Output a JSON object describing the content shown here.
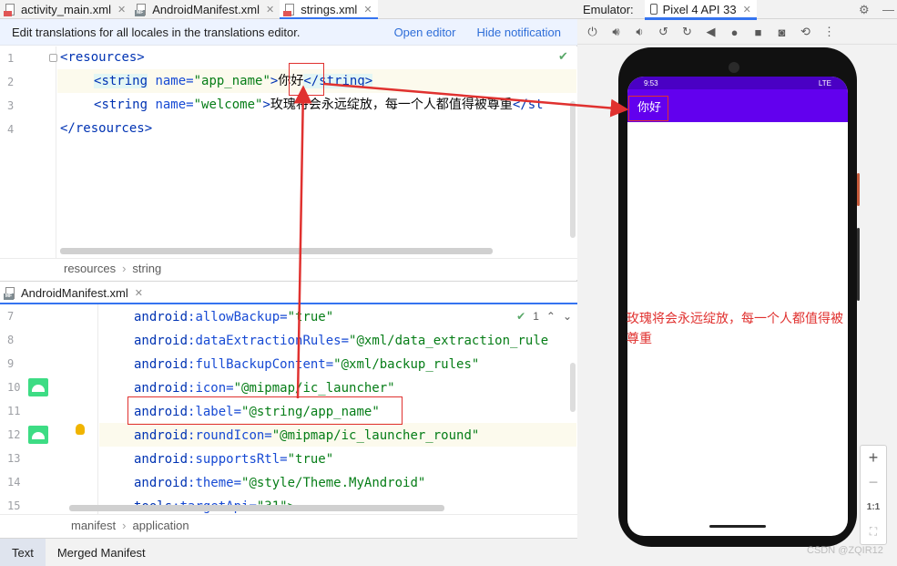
{
  "editor_tabs": [
    {
      "label": "activity_main.xml",
      "active": false
    },
    {
      "label": "AndroidManifest.xml",
      "active": false
    },
    {
      "label": "strings.xml",
      "active": true
    }
  ],
  "notification": {
    "message": "Edit translations for all locales in the translations editor.",
    "open_editor": "Open editor",
    "hide": "Hide notification"
  },
  "strings_editor": {
    "line_numbers": [
      "1",
      "2",
      "3",
      "4"
    ],
    "line1": {
      "open": "<",
      "tag": "resources",
      "close": ">"
    },
    "line2": {
      "open": "<",
      "tag": "string",
      "attr": " name=",
      "val": "\"app_name\"",
      "gt": ">",
      "text": "你好",
      "endtag": "</string>"
    },
    "line3": {
      "open": "<",
      "tag": "string",
      "attr": " name=",
      "val": "\"welcome\"",
      "gt": ">",
      "text": "玫瑰将会永远绽放，每一个人都值得被尊重",
      "endtag": "</st"
    },
    "line4": {
      "open": "</",
      "tag": "resources",
      "close": ">"
    },
    "breadcrumb": [
      "resources",
      "string"
    ]
  },
  "manifest_tab": {
    "label": "AndroidManifest.xml"
  },
  "manifest_editor": {
    "line_numbers": [
      "7",
      "8",
      "9",
      "10",
      "11",
      "12",
      "13",
      "14",
      "15"
    ],
    "lines": [
      {
        "ns": "android",
        "attr": ":allowBackup=",
        "val": "\"true\""
      },
      {
        "ns": "android",
        "attr": ":dataExtractionRules=",
        "val": "\"@xml/data_extraction_rule"
      },
      {
        "ns": "android",
        "attr": ":fullBackupContent=",
        "val": "\"@xml/backup_rules\""
      },
      {
        "ns": "android",
        "attr": ":icon=",
        "val": "\"@mipmap/ic_launcher\""
      },
      {
        "ns": "android",
        "attr": ":label=",
        "val": "\"@string/app_name\""
      },
      {
        "ns": "android",
        "attr": ":roundIcon=",
        "val": "\"@mipmap/ic_launcher_round\""
      },
      {
        "ns": "android",
        "attr": ":supportsRtl=",
        "val": "\"true\""
      },
      {
        "ns": "android",
        "attr": ":theme=",
        "val": "\"@style/Theme.MyAndroid\""
      },
      {
        "ns": "tools",
        "attr": ":targetApi=",
        "val": "\"31\">"
      }
    ],
    "inspection_count": "1",
    "breadcrumb": [
      "manifest",
      "application"
    ]
  },
  "bottom_tabs": [
    {
      "label": "Text",
      "active": true
    },
    {
      "label": "Merged Manifest",
      "active": false
    }
  ],
  "emulator": {
    "label": "Emulator:",
    "device": "Pixel 4 API 33",
    "status_time": "9:53",
    "status_right": "LTE",
    "app_title": "你好",
    "welcome_text": "玫瑰将会永远绽放，每一个人都值得被尊重",
    "zoom_in": "+",
    "zoom_out": "−",
    "zoom_actual": "1:1"
  },
  "watermark": "CSDN @ZQIR12",
  "colors": {
    "accent": "#3574f0",
    "app_bar": "#6200ee",
    "annotation": "#e0312f"
  }
}
